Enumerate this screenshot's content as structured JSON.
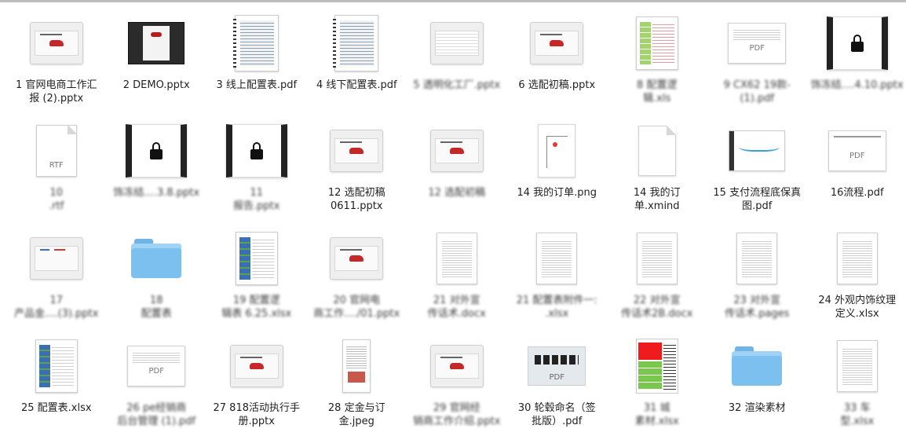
{
  "items": [
    {
      "kind": "slide",
      "l1": "1 官网电商工作汇",
      "l2": "报 (2).pptx",
      "blur": false
    },
    {
      "kind": "darkslide",
      "l1": "2 DEMO.pptx",
      "l2": "",
      "blur": false
    },
    {
      "kind": "spread",
      "l1": "3 线上配置表.pdf",
      "l2": "",
      "blur": false
    },
    {
      "kind": "spread",
      "l1": "4 线下配置表.pdf",
      "l2": "",
      "blur": false
    },
    {
      "kind": "slide2",
      "l1": "5 透明化工厂.pptx",
      "l2": "",
      "blur": true
    },
    {
      "kind": "slide",
      "l1": "6 选配初稿.pptx",
      "l2": "",
      "blur": false
    },
    {
      "kind": "greensheet",
      "l1": "8 配置逻",
      "l2": "辑.xls",
      "blur": true
    },
    {
      "kind": "pdfwide",
      "l1": "9 CX62 19款-",
      "l2": "(1).pdf",
      "blur": true
    },
    {
      "kind": "locked",
      "l1": "饰冻结....4.10.pptx",
      "l2": "",
      "blur": true
    },
    {
      "kind": "rtf",
      "l1": "10",
      "l2": ".rtf",
      "blur": true
    },
    {
      "kind": "locked",
      "l1": "饰冻结....3.8.pptx",
      "l2": "",
      "blur": true
    },
    {
      "kind": "locked",
      "l1": "11",
      "l2": "报告.pptx",
      "blur": true
    },
    {
      "kind": "slide",
      "l1": "12 选配初稿",
      "l2": "0611.pptx",
      "blur": false
    },
    {
      "kind": "slide",
      "l1": "12 选配初稿",
      "l2": "",
      "blur": true
    },
    {
      "kind": "png",
      "l1": "14 我的订单.png",
      "l2": "",
      "blur": false
    },
    {
      "kind": "blank",
      "l1": "14 我的订",
      "l2": "单.xmind",
      "blur": false
    },
    {
      "kind": "dashboard",
      "l1": "15 支付流程底保真",
      "l2": "图.pdf",
      "blur": false
    },
    {
      "kind": "pdfdiagram",
      "l1": "16流程.pdf",
      "l2": "",
      "blur": false
    },
    {
      "kind": "slide3",
      "l1": "17",
      "l2": "产品金....(3).pptx",
      "blur": true
    },
    {
      "kind": "folder",
      "l1": "18",
      "l2": "配置表",
      "blur": true
    },
    {
      "kind": "bluesheet",
      "l1": "19 配置逻",
      "l2": "辑表 6.25.xlsx",
      "blur": true
    },
    {
      "kind": "slide",
      "l1": "20 官网电",
      "l2": "商工作..../01.pptx",
      "blur": true
    },
    {
      "kind": "doc",
      "l1": "21 对外宣",
      "l2": "传话术.docx",
      "blur": true
    },
    {
      "kind": "doc",
      "l1": "21 配置表附件一:",
      "l2": ".xlsx",
      "blur": true
    },
    {
      "kind": "doc",
      "l1": "22 对外宣",
      "l2": "传话术2B.docx",
      "blur": true
    },
    {
      "kind": "doc",
      "l1": "23 对外宣",
      "l2": "传话术.pages",
      "blur": true
    },
    {
      "kind": "doc",
      "l1": "24 外观内饰纹理",
      "l2": "定义.xlsx",
      "blur": false
    },
    {
      "kind": "bluesheet",
      "l1": "25 配置表.xlsx",
      "l2": "",
      "blur": false
    },
    {
      "kind": "pdfwide",
      "l1": "26 pe经销商",
      "l2": "后台管理 (1).pdf",
      "blur": true
    },
    {
      "kind": "slide",
      "l1": "27 818活动执行手",
      "l2": "册.pptx",
      "blur": false
    },
    {
      "kind": "jpeg",
      "l1": "28 定金与订",
      "l2": "金.jpeg",
      "blur": false
    },
    {
      "kind": "slide",
      "l1": "29 官网经",
      "l2": "销商工作介绍.pptx",
      "blur": true
    },
    {
      "kind": "tires",
      "l1": "30 轮毂命名（签",
      "l2": "批版）.pdf",
      "blur": false
    },
    {
      "kind": "redsheet",
      "l1": "31 城",
      "l2": "素材.xlsx",
      "blur": true
    },
    {
      "kind": "folder",
      "l1": "32 渲染素材",
      "l2": "",
      "blur": false
    },
    {
      "kind": "doc",
      "l1": "33 车",
      "l2": "型.xlsx",
      "blur": true
    }
  ]
}
